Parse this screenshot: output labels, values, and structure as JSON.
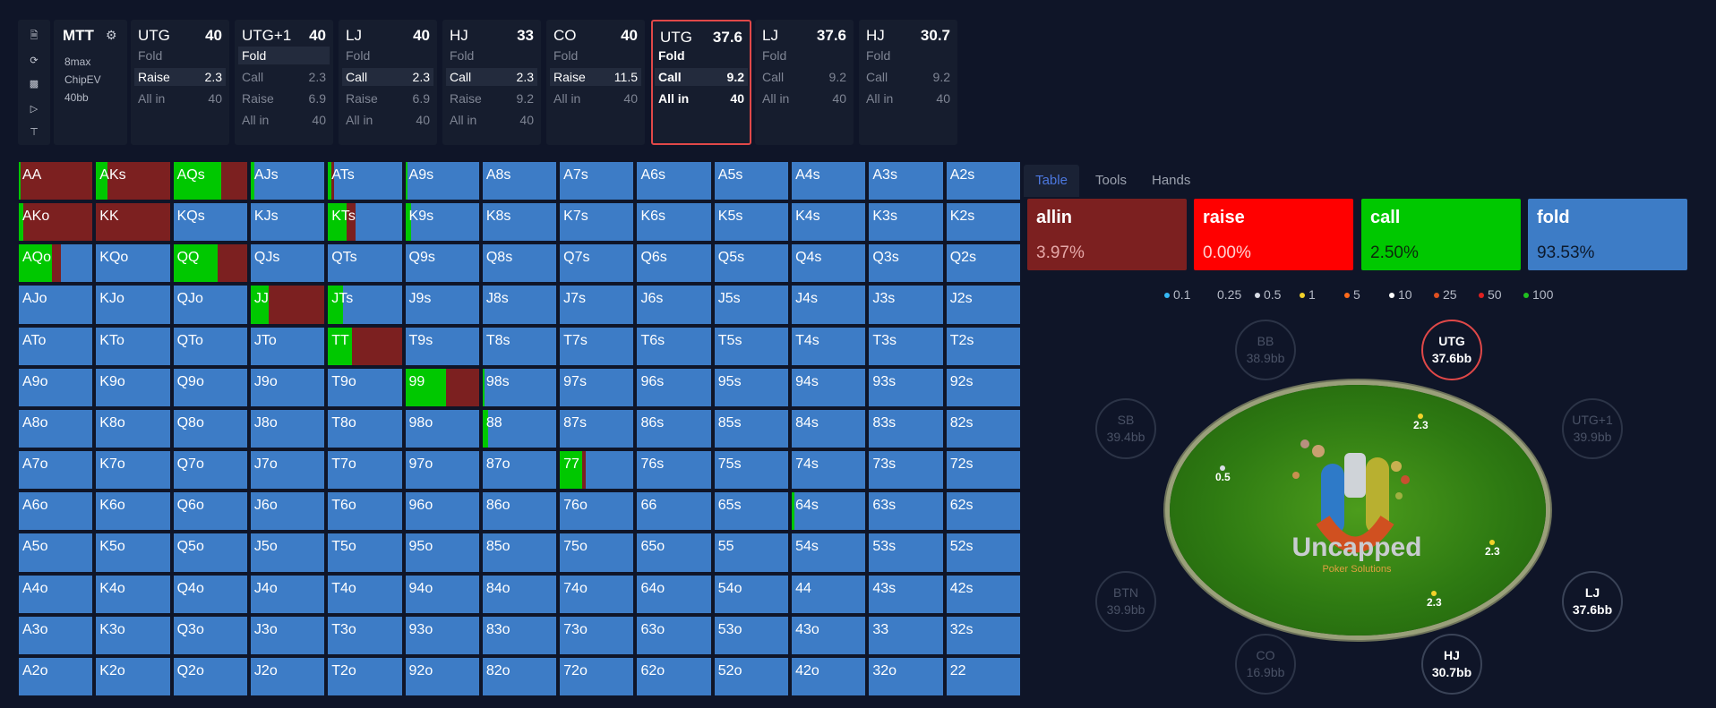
{
  "toolbar": {
    "icons": [
      "file-icon",
      "refresh-icon",
      "save-icon",
      "play-icon",
      "text-cursor-icon"
    ]
  },
  "info": {
    "title": "MTT",
    "settings_icon": "gear-icon",
    "lines": [
      "8max",
      "ChipEV",
      "40bb"
    ]
  },
  "positions": [
    {
      "name": "UTG",
      "stack": "40",
      "rows": [
        {
          "label": "Fold",
          "value": ""
        },
        {
          "label": "Raise",
          "value": "2.3"
        },
        {
          "label": "All in",
          "value": "40"
        }
      ]
    },
    {
      "name": "UTG+1",
      "stack": "40",
      "rows": [
        {
          "label": "Fold",
          "value": ""
        },
        {
          "label": "Call",
          "value": "2.3"
        },
        {
          "label": "Raise",
          "value": "6.9"
        },
        {
          "label": "All in",
          "value": "40"
        }
      ]
    },
    {
      "name": "LJ",
      "stack": "40",
      "rows": [
        {
          "label": "Fold",
          "value": ""
        },
        {
          "label": "Call",
          "value": "2.3"
        },
        {
          "label": "Raise",
          "value": "6.9"
        },
        {
          "label": "All in",
          "value": "40"
        }
      ]
    },
    {
      "name": "HJ",
      "stack": "33",
      "rows": [
        {
          "label": "Fold",
          "value": ""
        },
        {
          "label": "Call",
          "value": "2.3"
        },
        {
          "label": "Raise",
          "value": "9.2"
        },
        {
          "label": "All in",
          "value": "40"
        }
      ]
    },
    {
      "name": "CO",
      "stack": "40",
      "rows": [
        {
          "label": "Fold",
          "value": ""
        },
        {
          "label": "Raise",
          "value": "11.5"
        },
        {
          "label": "All in",
          "value": "40"
        }
      ]
    },
    {
      "name": "UTG",
      "stack": "37.6",
      "rows": [
        {
          "label": "Fold",
          "value": ""
        },
        {
          "label": "Call",
          "value": "9.2"
        },
        {
          "label": "All in",
          "value": "40"
        }
      ]
    },
    {
      "name": "LJ",
      "stack": "37.6",
      "rows": [
        {
          "label": "Fold",
          "value": ""
        },
        {
          "label": "Call",
          "value": "9.2"
        },
        {
          "label": "All in",
          "value": "40"
        }
      ]
    },
    {
      "name": "HJ",
      "stack": "30.7",
      "rows": [
        {
          "label": "Fold",
          "value": ""
        },
        {
          "label": "Call",
          "value": "9.2"
        },
        {
          "label": "All in",
          "value": "40"
        }
      ]
    }
  ],
  "colors": {
    "allin": "#7c2020",
    "raise": "#ff0000",
    "call": "#00c800",
    "fold": "#3d7cc6"
  },
  "grid": {
    "ranks": [
      "A",
      "K",
      "Q",
      "J",
      "T",
      "9",
      "8",
      "7",
      "6",
      "5",
      "4",
      "3",
      "2"
    ],
    "mixes": {
      "AA": [
        0.03,
        0.97,
        0
      ],
      "AKs": [
        0.15,
        0.85,
        0
      ],
      "AQs": [
        0.65,
        0.35,
        0
      ],
      "AJs": [
        0.05,
        0,
        0.95
      ],
      "ATs": [
        0.05,
        0.03,
        0.92
      ],
      "A9s": [
        0.03,
        0,
        0.97
      ],
      "AKo": [
        0.06,
        0.94,
        0
      ],
      "KK": [
        0,
        1,
        0
      ],
      "KTs": [
        0.25,
        0.12,
        0.63
      ],
      "K9s": [
        0.08,
        0,
        0.92
      ],
      "AQo": [
        0.45,
        0.12,
        0.43
      ],
      "QQ": [
        0.6,
        0.4,
        0
      ],
      "JJ": [
        0.25,
        0.75,
        0
      ],
      "JTs": [
        0.2,
        0,
        0.8
      ],
      "TT": [
        0.32,
        0.68,
        0
      ],
      "99": [
        0.55,
        0.45,
        0
      ],
      "98s": [
        0.03,
        0,
        0.97
      ],
      "88": [
        0.08,
        0,
        0.92
      ],
      "77": [
        0.3,
        0.05,
        0.65
      ],
      "64s": [
        0.03,
        0,
        0.97
      ]
    }
  },
  "panel": {
    "tabs": [
      "Table",
      "Tools",
      "Hands"
    ],
    "actions": [
      {
        "key": "allin",
        "name": "allin",
        "pct": "3.97%"
      },
      {
        "key": "raise",
        "name": "raise",
        "pct": "0.00%"
      },
      {
        "key": "call",
        "name": "call",
        "pct": "2.50%"
      },
      {
        "key": "fold",
        "name": "fold",
        "pct": "93.53%"
      }
    ],
    "chips": [
      {
        "label": "0.1",
        "color": "#35b8f5"
      },
      {
        "label": "0.25",
        "color": ""
      },
      {
        "label": "0.5",
        "color": "#d8dde6"
      },
      {
        "label": "1",
        "color": "#f2d22a"
      },
      {
        "label": "5",
        "color": "#ff6a1a"
      },
      {
        "label": "10",
        "color": "#ffffff"
      },
      {
        "label": "25",
        "color": "#e05020"
      },
      {
        "label": "50",
        "color": "#e02020"
      },
      {
        "label": "100",
        "color": "#20c020"
      }
    ]
  },
  "table": {
    "seats": [
      {
        "name": "BB",
        "stack": "38.9bb",
        "state": "off"
      },
      {
        "name": "UTG",
        "stack": "37.6bb",
        "state": "hot"
      },
      {
        "name": "SB",
        "stack": "39.4bb",
        "state": "off"
      },
      {
        "name": "UTG+1",
        "stack": "39.9bb",
        "state": "off"
      },
      {
        "name": "BTN",
        "stack": "39.9bb",
        "state": "off"
      },
      {
        "name": "LJ",
        "stack": "37.6bb",
        "state": "on"
      },
      {
        "name": "CO",
        "stack": "16.9bb",
        "state": "off"
      },
      {
        "name": "HJ",
        "stack": "30.7bb",
        "state": "on"
      }
    ],
    "bets": [
      "2.3",
      "0.5",
      "2.3",
      "2.3"
    ],
    "logo": {
      "name": "Uncapped",
      "sub": "Poker Solutions"
    }
  }
}
